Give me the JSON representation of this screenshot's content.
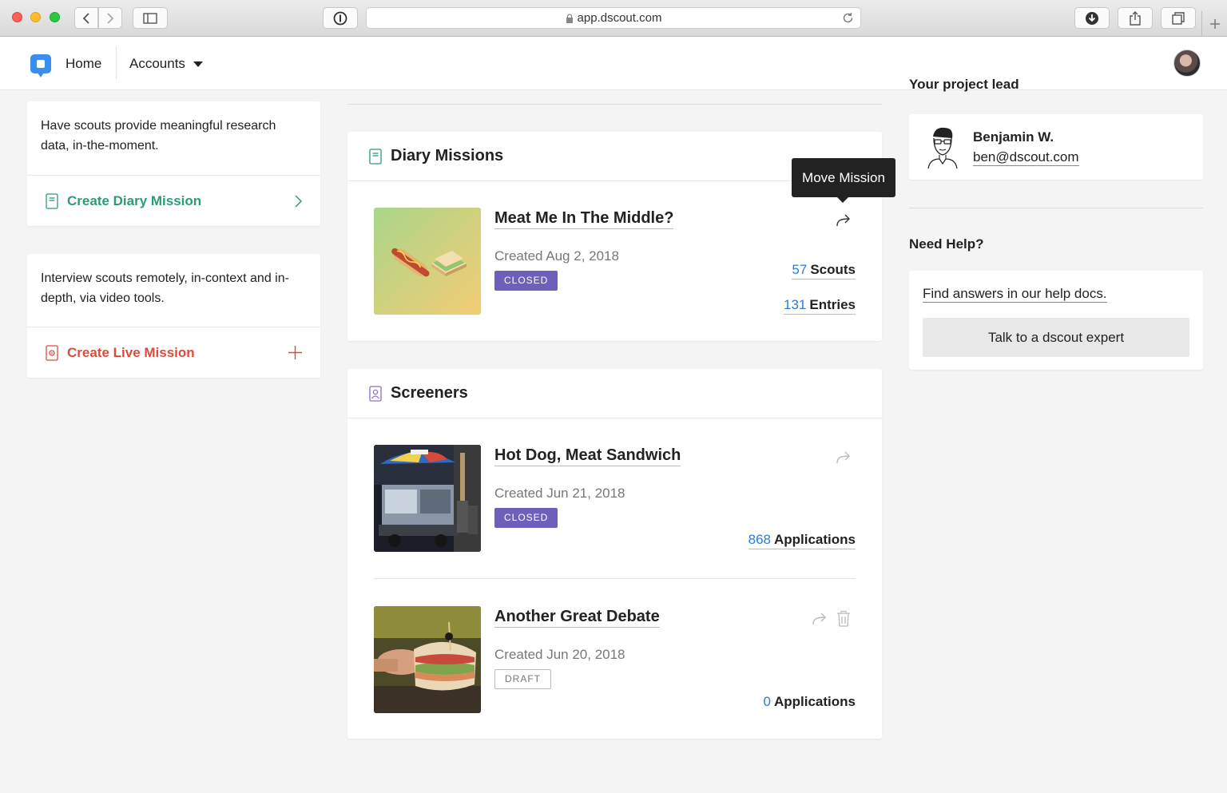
{
  "browser": {
    "url": "app.dscout.com"
  },
  "nav": {
    "home": "Home",
    "accounts": "Accounts"
  },
  "left": {
    "diary_card": {
      "description": "Have scouts provide meaningful research data, in-the-moment.",
      "action": "Create Diary Mission"
    },
    "live_card": {
      "description": "Interview scouts remotely, in-context and in-depth, via video tools.",
      "action": "Create Live Mission"
    }
  },
  "diary": {
    "section_title": "Diary Missions",
    "tooltip": "Move Mission",
    "missions": [
      {
        "title": "Meat Me In The Middle?",
        "created": "Created Aug 2, 2018",
        "status": "CLOSED",
        "scouts_count": "57",
        "scouts_label": "Scouts",
        "entries_count": "131",
        "entries_label": "Entries"
      }
    ]
  },
  "screeners": {
    "section_title": "Screeners",
    "items": [
      {
        "title": "Hot Dog, Meat Sandwich",
        "created": "Created Jun 21, 2018",
        "status": "CLOSED",
        "count": "868",
        "count_label": "Applications"
      },
      {
        "title": "Another Great Debate",
        "created": "Created Jun 20, 2018",
        "status": "DRAFT",
        "count": "0",
        "count_label": "Applications"
      }
    ]
  },
  "right": {
    "lead_heading": "Your project lead",
    "lead": {
      "name": "Benjamin W.",
      "email": "ben@dscout.com"
    },
    "help": {
      "title": "Need Help?",
      "link": "Find answers in our help docs.",
      "button": "Talk to a dscout expert"
    }
  },
  "colors": {
    "accent_blue": "#2f7bd8",
    "diary_green": "#2e9b71",
    "live_red": "#d84d3e",
    "closed_purple": "#6f5fbd"
  }
}
